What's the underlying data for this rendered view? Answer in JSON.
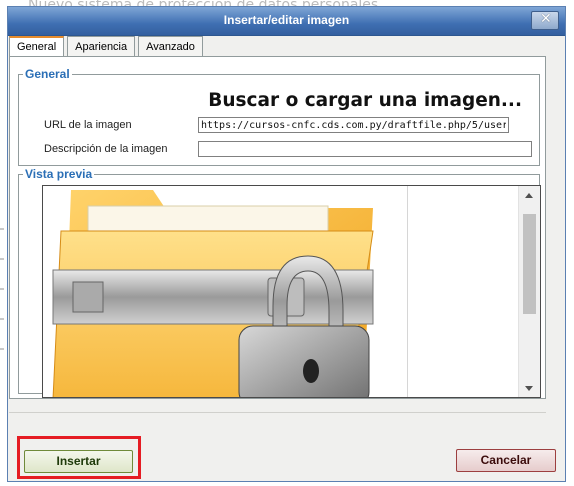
{
  "background": {
    "text": "Nuevo sistema de protección de datos personales"
  },
  "dialog": {
    "title": "Insertar/editar imagen",
    "close_icon": "close-x-icon"
  },
  "tabs": [
    {
      "label": "General",
      "active": true
    },
    {
      "label": "Apariencia",
      "active": false
    },
    {
      "label": "Avanzado",
      "active": false
    }
  ],
  "general": {
    "legend": "General",
    "browse_label": "Buscar o cargar una imagen...",
    "browse_icon": "search-image-icon",
    "url_label": "URL de la imagen",
    "url_value": "https://cursos-cnfc.cds.com.py/draftfile.php/5/user",
    "desc_label": "Descripción de la imagen",
    "desc_value": ""
  },
  "preview": {
    "legend": "Vista previa",
    "image": "folder-with-padlock-image"
  },
  "buttons": {
    "insert": "Insertar",
    "cancel": "Cancelar"
  },
  "colors": {
    "titlebar": "#3f6fb2",
    "legend": "#2b6fb6",
    "highlight": "#e51c23",
    "folder": "#f6b73c"
  }
}
